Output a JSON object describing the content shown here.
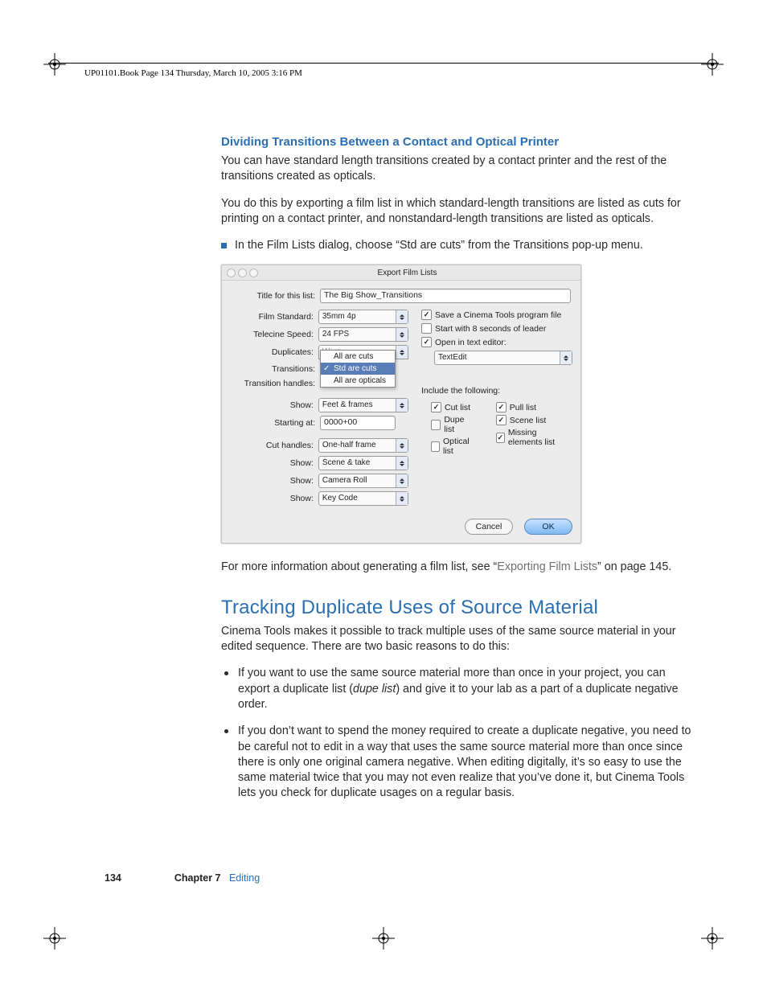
{
  "header": "UP01101.Book  Page 134  Thursday, March 10, 2005  3:16 PM",
  "section1": {
    "title": "Dividing Transitions Between a Contact and Optical Printer",
    "p1": "You can have standard length transitions created by a contact printer and the rest of the transitions created as opticals.",
    "p2": "You do this by exporting a film list in which standard-length transitions are listed as cuts for printing on a contact printer, and nonstandard-length transitions are listed as opticals.",
    "bullet": "In the Film Lists dialog, choose “Std are cuts” from the Transitions pop-up menu."
  },
  "dialog": {
    "title": "Export Film Lists",
    "fields": {
      "title_label": "Title for this list:",
      "title_value": "The Big Show_Transitions",
      "film_standard_label": "Film Standard:",
      "film_standard_value": "35mm 4p",
      "telecine_label": "Telecine Speed:",
      "telecine_value": "24 FPS",
      "duplicates_label": "Duplicates:",
      "duplicates_value": "Warn",
      "transitions_label": "Transitions:",
      "transitions_options": [
        "All are cuts",
        "Std are cuts",
        "All are opticals"
      ],
      "transition_handles_label": "Transition handles:",
      "show1_label": "Show:",
      "show1_value": "Feet & frames",
      "starting_label": "Starting at:",
      "starting_value": "0000+00",
      "cut_handles_label": "Cut handles:",
      "cut_handles_value": "One-half frame",
      "show2_label": "Show:",
      "show2_value": "Scene & take",
      "show3_label": "Show:",
      "show3_value": "Camera Roll",
      "show4_label": "Show:",
      "show4_value": "Key Code"
    },
    "right": {
      "save_program": "Save a Cinema Tools program file",
      "start_leader": "Start with 8 seconds of leader",
      "open_editor": "Open in text editor:",
      "editor_value": "TextEdit",
      "include_label": "Include the following:",
      "checks": {
        "cut_list": "Cut list",
        "dupe_list": "Dupe list",
        "optical_list": "Optical list",
        "pull_list": "Pull list",
        "scene_list": "Scene list",
        "missing_list": "Missing elements list"
      }
    },
    "buttons": {
      "cancel": "Cancel",
      "ok": "OK"
    }
  },
  "postdialog": {
    "pre": "For more information about generating a film list, see “",
    "link": "Exporting Film Lists",
    "post": "” on page 145."
  },
  "section2": {
    "title": "Tracking Duplicate Uses of Source Material",
    "intro": "Cinema Tools makes it possible to track multiple uses of the same source material in your edited sequence. There are two basic reasons to do this:",
    "b1_pre": "If you want to use the same source material more than once in your project, you can export a duplicate list (",
    "b1_em": "dupe list",
    "b1_post": ") and give it to your lab as a part of a duplicate negative order.",
    "b2": "If you don’t want to spend the money required to create a duplicate negative, you need to be careful not to edit in a way that uses the same source material more than once since there is only one original camera negative. When editing digitally, it’s so easy to use the same material twice that you may not even realize that you’ve done it, but Cinema Tools lets you check for duplicate usages on a regular basis."
  },
  "footer": {
    "page": "134",
    "chapter_label": "Chapter 7",
    "chapter_title": "Editing"
  }
}
